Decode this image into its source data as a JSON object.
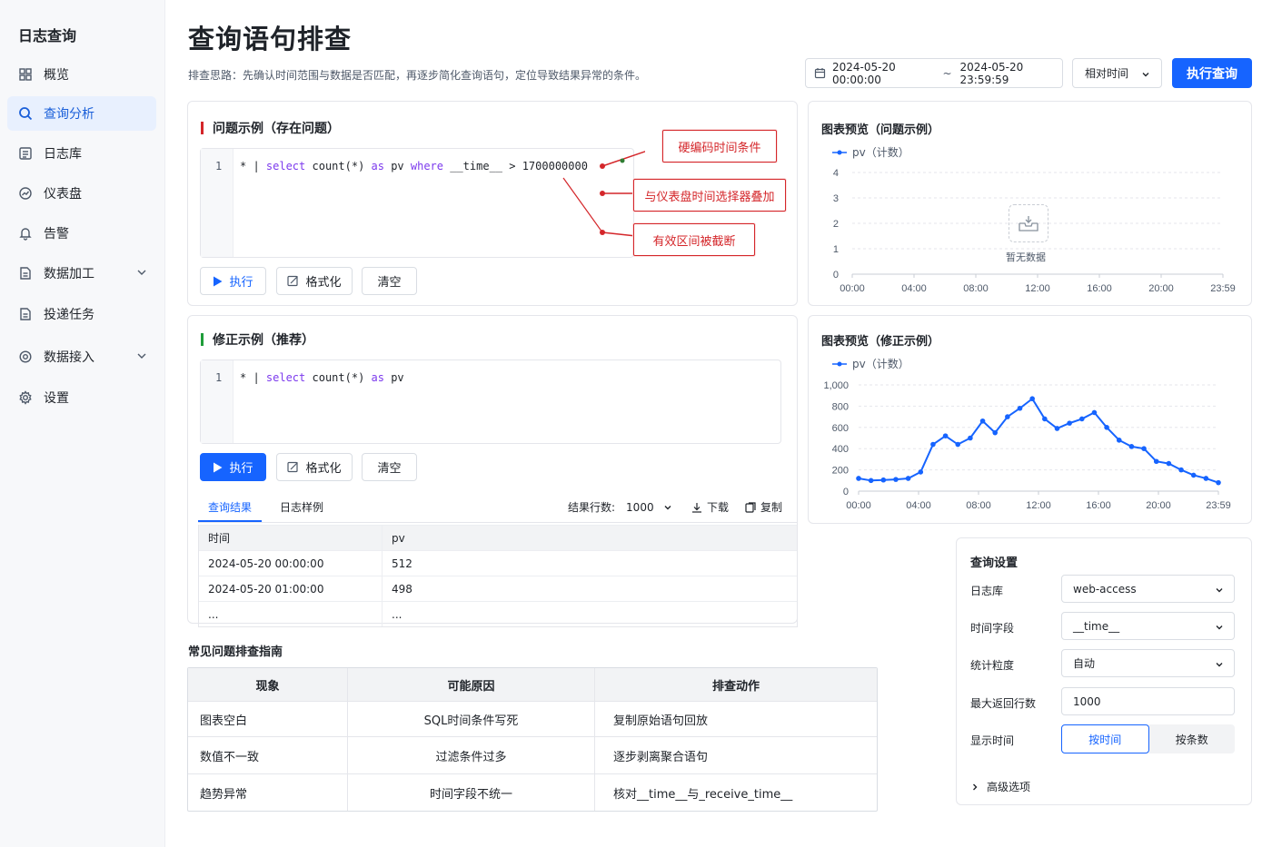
{
  "sidebar": {
    "brand": "日志查询",
    "items": [
      {
        "label": "概览",
        "icon": "grid-icon"
      },
      {
        "label": "查询分析",
        "icon": "search-icon",
        "active": true
      },
      {
        "label": "日志库",
        "icon": "list-icon"
      },
      {
        "label": "仪表盘",
        "icon": "dashboard-icon"
      },
      {
        "label": "告警",
        "icon": "bell-icon"
      },
      {
        "label": "数据加工",
        "icon": "document-icon",
        "expandable": true
      },
      {
        "label": "投递任务",
        "icon": "document-icon"
      },
      {
        "label": "数据接入",
        "icon": "gear-icon",
        "expandable": true
      },
      {
        "label": "设置",
        "icon": "gear-icon"
      }
    ]
  },
  "header": {
    "title": "查询语句排查",
    "desc": "排查思路：先确认时间范围与数据是否匹配，再逐步简化查询语句，定位导致结果异常的条件。",
    "date_start": "2024-05-20 00:00:00",
    "date_sep": "~",
    "date_end": "2024-05-20 23:59:59",
    "rel_time": "相对时间",
    "run_label": "执行查询"
  },
  "problem": {
    "title": "问题示例（存在问题）",
    "line_no": "1",
    "code_prefix": "* | ",
    "code_kw1": "select",
    "code_mid1": " count(*) ",
    "code_kw2": "as",
    "code_mid2": " pv ",
    "code_kw3": "where",
    "code_tail": " __time__ > 1700000000",
    "btn_run": "执行",
    "btn_format": "格式化",
    "btn_clear": "清空",
    "annotations": [
      "硬编码时间条件",
      "与仪表盘时间选择器叠加",
      "有效区间被截断"
    ]
  },
  "problem_chart": {
    "title": "图表预览（问题示例）",
    "legend": "pv（计数）",
    "empty_text": "暂无数据"
  },
  "fixed": {
    "title": "修正示例（推荐）",
    "line_no": "1",
    "code_prefix": "* | ",
    "code_kw1": "select",
    "code_mid1": " count(*) ",
    "code_kw2": "as",
    "code_tail": " pv",
    "btn_run": "执行",
    "btn_format": "格式化",
    "btn_clear": "清空"
  },
  "fixed_chart": {
    "title": "图表预览（修正示例）",
    "legend": "pv（计数）"
  },
  "chart_data": [
    {
      "type": "line",
      "series": [
        {
          "name": "pv（计数）",
          "values": []
        }
      ],
      "x_ticks": [
        "00:00",
        "04:00",
        "08:00",
        "12:00",
        "16:00",
        "20:00",
        "23:59"
      ],
      "y_ticks": [
        "0",
        "1",
        "2",
        "3",
        "4"
      ],
      "ylim": [
        0,
        4
      ],
      "annotation": "暂无数据",
      "grid": true
    },
    {
      "type": "line",
      "series": [
        {
          "name": "pv（计数）",
          "color": "#1664ff",
          "values": [
            120,
            100,
            105,
            110,
            120,
            180,
            440,
            520,
            440,
            500,
            660,
            550,
            700,
            780,
            870,
            680,
            590,
            640,
            680,
            740,
            600,
            480,
            420,
            400,
            280,
            260,
            200,
            150,
            120,
            80
          ]
        }
      ],
      "x_ticks": [
        "00:00",
        "04:00",
        "08:00",
        "12:00",
        "16:00",
        "20:00",
        "23:59"
      ],
      "y_ticks": [
        "0",
        "200",
        "400",
        "600",
        "800",
        "1,000"
      ],
      "ylim": [
        0,
        1000
      ],
      "grid": true
    }
  ],
  "results": {
    "tab_result": "查询结果",
    "tab_sample": "日志样例",
    "rows_label": "结果行数:",
    "rows_value": "1000",
    "download": "下载",
    "copy": "复制",
    "columns": [
      "时间",
      "pv"
    ],
    "rows": [
      [
        "2024-05-20 00:00:00",
        "512"
      ],
      [
        "2024-05-20 01:00:00",
        "498"
      ],
      [
        "...",
        "..."
      ]
    ]
  },
  "guide": {
    "title": "常见问题排查指南",
    "columns": [
      "现象",
      "可能原因",
      "排查动作"
    ],
    "rows": [
      [
        "图表空白",
        "SQL时间条件写死",
        "复制原始语句回放"
      ],
      [
        "数值不一致",
        "过滤条件过多",
        "逐步剥离聚合语句"
      ],
      [
        "趋势异常",
        "时间字段不统一",
        "核对__time__与_receive_time__"
      ]
    ]
  },
  "settings": {
    "title": "查询设置",
    "logstore_label": "日志库",
    "logstore_value": "web-access",
    "timefield_label": "时间字段",
    "timefield_value": "__time__",
    "granularity_label": "统计粒度",
    "granularity_value": "自动",
    "maxrows_label": "最大返回行数",
    "maxrows_value": "1000",
    "display_label": "显示时间",
    "display_opt1": "按时间",
    "display_opt2": "按条数",
    "advanced": "高级选项"
  },
  "colors": {
    "accent": "#1664ff",
    "danger": "#d4262a",
    "success": "#1f9d3a"
  }
}
